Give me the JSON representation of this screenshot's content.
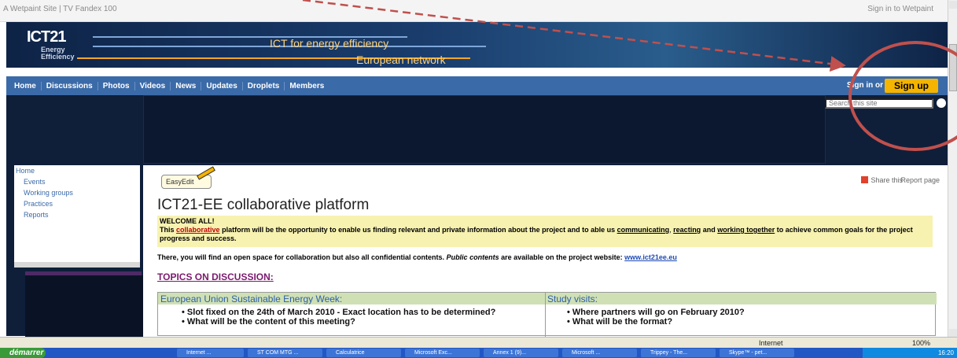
{
  "topbar": {
    "left": "A Wetpaint Site | TV Fandex 100",
    "right": "Sign in to Wetpaint"
  },
  "banner": {
    "logo_main": "ICT21",
    "logo_sub1": "Energy",
    "logo_sub2": "Efficiency",
    "tagline1": "ICT for energy efficiency",
    "tagline2": "European network"
  },
  "nav": {
    "items": [
      "Home",
      "Discussions",
      "Photos",
      "Videos",
      "News",
      "Updates",
      "Droplets",
      "Members"
    ],
    "signin": "Sign in or",
    "signup": "Sign up"
  },
  "search": {
    "placeholder": "Search this site"
  },
  "sidebar": {
    "items": [
      "Home",
      "Events",
      "Working groups",
      "Practices",
      "Reports"
    ]
  },
  "content": {
    "easyedit": "EasyEdit",
    "share": "Share this",
    "report": "Report page",
    "title": "ICT21-EE collaborative platform",
    "welcome_title": "WELCOME ALL!",
    "welcome_p1": "This",
    "welcome_collab": "collaborative",
    "welcome_p2": "platform will be the opportunity to enable us finding relevant and private information about the project and to able us",
    "welcome_communicating": "communicating",
    "welcome_reacting": "reacting",
    "welcome_and": "and",
    "welcome_working": "working together",
    "welcome_p3": "to achieve common goals for the project progress and success.",
    "there_p1": "There, you will find an open space for collaboration but also all confidential contents.",
    "there_public": "Public contents",
    "there_p2": "are available on the project website:",
    "there_link": "www.ict21ee.eu",
    "topics": "TOPICS ON DISCUSSION:",
    "table": {
      "col1": "European Union Sustainable Energy Week:",
      "col2": "Study visits:",
      "col1_items": [
        "Slot fixed on the 24th of March 2010 - Exact location has to be determined?",
        "What will be the content of this meeting?"
      ],
      "col2_items": [
        "Where partners will go on February 2010?",
        "What will be the format?"
      ]
    }
  },
  "statusbar": {
    "internet": "Internet",
    "zoom": "100%"
  },
  "taskbar": {
    "start": "démarrer",
    "tasks": [
      "Internet ...",
      "ST COM MTG ...",
      "Calculatrice",
      "Microsoft Exc...",
      "Annex 1 (9)...",
      "Microsoft ...",
      "Trippey - The...",
      "Skype™ - pet..."
    ],
    "time": "16:20"
  },
  "colors": {
    "banner": "#0e2346",
    "nav": "#3b6aa8",
    "signup": "#f5b400",
    "annotation": "#c0504d"
  }
}
